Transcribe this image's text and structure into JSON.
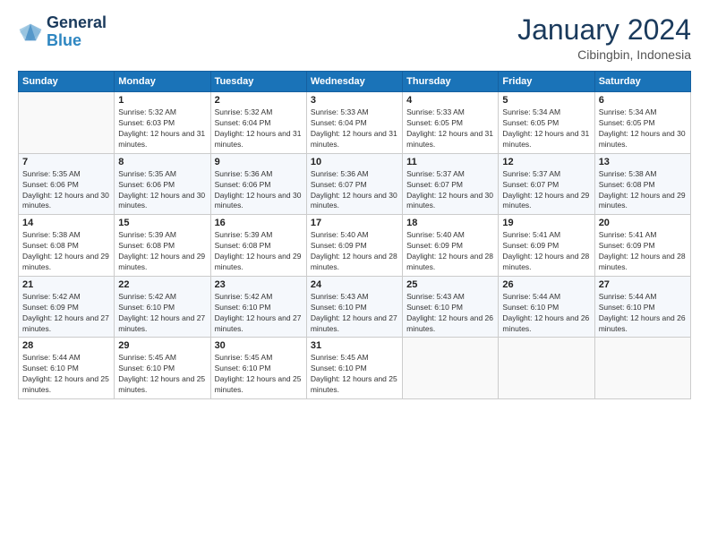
{
  "logo": {
    "line1": "General",
    "line2": "Blue"
  },
  "header": {
    "month": "January 2024",
    "location": "Cibingbin, Indonesia"
  },
  "weekdays": [
    "Sunday",
    "Monday",
    "Tuesday",
    "Wednesday",
    "Thursday",
    "Friday",
    "Saturday"
  ],
  "weeks": [
    [
      {
        "day": "",
        "sunrise": "",
        "sunset": "",
        "daylight": ""
      },
      {
        "day": "1",
        "sunrise": "Sunrise: 5:32 AM",
        "sunset": "Sunset: 6:03 PM",
        "daylight": "Daylight: 12 hours and 31 minutes."
      },
      {
        "day": "2",
        "sunrise": "Sunrise: 5:32 AM",
        "sunset": "Sunset: 6:04 PM",
        "daylight": "Daylight: 12 hours and 31 minutes."
      },
      {
        "day": "3",
        "sunrise": "Sunrise: 5:33 AM",
        "sunset": "Sunset: 6:04 PM",
        "daylight": "Daylight: 12 hours and 31 minutes."
      },
      {
        "day": "4",
        "sunrise": "Sunrise: 5:33 AM",
        "sunset": "Sunset: 6:05 PM",
        "daylight": "Daylight: 12 hours and 31 minutes."
      },
      {
        "day": "5",
        "sunrise": "Sunrise: 5:34 AM",
        "sunset": "Sunset: 6:05 PM",
        "daylight": "Daylight: 12 hours and 31 minutes."
      },
      {
        "day": "6",
        "sunrise": "Sunrise: 5:34 AM",
        "sunset": "Sunset: 6:05 PM",
        "daylight": "Daylight: 12 hours and 30 minutes."
      }
    ],
    [
      {
        "day": "7",
        "sunrise": "Sunrise: 5:35 AM",
        "sunset": "Sunset: 6:06 PM",
        "daylight": "Daylight: 12 hours and 30 minutes."
      },
      {
        "day": "8",
        "sunrise": "Sunrise: 5:35 AM",
        "sunset": "Sunset: 6:06 PM",
        "daylight": "Daylight: 12 hours and 30 minutes."
      },
      {
        "day": "9",
        "sunrise": "Sunrise: 5:36 AM",
        "sunset": "Sunset: 6:06 PM",
        "daylight": "Daylight: 12 hours and 30 minutes."
      },
      {
        "day": "10",
        "sunrise": "Sunrise: 5:36 AM",
        "sunset": "Sunset: 6:07 PM",
        "daylight": "Daylight: 12 hours and 30 minutes."
      },
      {
        "day": "11",
        "sunrise": "Sunrise: 5:37 AM",
        "sunset": "Sunset: 6:07 PM",
        "daylight": "Daylight: 12 hours and 30 minutes."
      },
      {
        "day": "12",
        "sunrise": "Sunrise: 5:37 AM",
        "sunset": "Sunset: 6:07 PM",
        "daylight": "Daylight: 12 hours and 29 minutes."
      },
      {
        "day": "13",
        "sunrise": "Sunrise: 5:38 AM",
        "sunset": "Sunset: 6:08 PM",
        "daylight": "Daylight: 12 hours and 29 minutes."
      }
    ],
    [
      {
        "day": "14",
        "sunrise": "Sunrise: 5:38 AM",
        "sunset": "Sunset: 6:08 PM",
        "daylight": "Daylight: 12 hours and 29 minutes."
      },
      {
        "day": "15",
        "sunrise": "Sunrise: 5:39 AM",
        "sunset": "Sunset: 6:08 PM",
        "daylight": "Daylight: 12 hours and 29 minutes."
      },
      {
        "day": "16",
        "sunrise": "Sunrise: 5:39 AM",
        "sunset": "Sunset: 6:08 PM",
        "daylight": "Daylight: 12 hours and 29 minutes."
      },
      {
        "day": "17",
        "sunrise": "Sunrise: 5:40 AM",
        "sunset": "Sunset: 6:09 PM",
        "daylight": "Daylight: 12 hours and 28 minutes."
      },
      {
        "day": "18",
        "sunrise": "Sunrise: 5:40 AM",
        "sunset": "Sunset: 6:09 PM",
        "daylight": "Daylight: 12 hours and 28 minutes."
      },
      {
        "day": "19",
        "sunrise": "Sunrise: 5:41 AM",
        "sunset": "Sunset: 6:09 PM",
        "daylight": "Daylight: 12 hours and 28 minutes."
      },
      {
        "day": "20",
        "sunrise": "Sunrise: 5:41 AM",
        "sunset": "Sunset: 6:09 PM",
        "daylight": "Daylight: 12 hours and 28 minutes."
      }
    ],
    [
      {
        "day": "21",
        "sunrise": "Sunrise: 5:42 AM",
        "sunset": "Sunset: 6:09 PM",
        "daylight": "Daylight: 12 hours and 27 minutes."
      },
      {
        "day": "22",
        "sunrise": "Sunrise: 5:42 AM",
        "sunset": "Sunset: 6:10 PM",
        "daylight": "Daylight: 12 hours and 27 minutes."
      },
      {
        "day": "23",
        "sunrise": "Sunrise: 5:42 AM",
        "sunset": "Sunset: 6:10 PM",
        "daylight": "Daylight: 12 hours and 27 minutes."
      },
      {
        "day": "24",
        "sunrise": "Sunrise: 5:43 AM",
        "sunset": "Sunset: 6:10 PM",
        "daylight": "Daylight: 12 hours and 27 minutes."
      },
      {
        "day": "25",
        "sunrise": "Sunrise: 5:43 AM",
        "sunset": "Sunset: 6:10 PM",
        "daylight": "Daylight: 12 hours and 26 minutes."
      },
      {
        "day": "26",
        "sunrise": "Sunrise: 5:44 AM",
        "sunset": "Sunset: 6:10 PM",
        "daylight": "Daylight: 12 hours and 26 minutes."
      },
      {
        "day": "27",
        "sunrise": "Sunrise: 5:44 AM",
        "sunset": "Sunset: 6:10 PM",
        "daylight": "Daylight: 12 hours and 26 minutes."
      }
    ],
    [
      {
        "day": "28",
        "sunrise": "Sunrise: 5:44 AM",
        "sunset": "Sunset: 6:10 PM",
        "daylight": "Daylight: 12 hours and 25 minutes."
      },
      {
        "day": "29",
        "sunrise": "Sunrise: 5:45 AM",
        "sunset": "Sunset: 6:10 PM",
        "daylight": "Daylight: 12 hours and 25 minutes."
      },
      {
        "day": "30",
        "sunrise": "Sunrise: 5:45 AM",
        "sunset": "Sunset: 6:10 PM",
        "daylight": "Daylight: 12 hours and 25 minutes."
      },
      {
        "day": "31",
        "sunrise": "Sunrise: 5:45 AM",
        "sunset": "Sunset: 6:10 PM",
        "daylight": "Daylight: 12 hours and 25 minutes."
      },
      {
        "day": "",
        "sunrise": "",
        "sunset": "",
        "daylight": ""
      },
      {
        "day": "",
        "sunrise": "",
        "sunset": "",
        "daylight": ""
      },
      {
        "day": "",
        "sunrise": "",
        "sunset": "",
        "daylight": ""
      }
    ]
  ]
}
